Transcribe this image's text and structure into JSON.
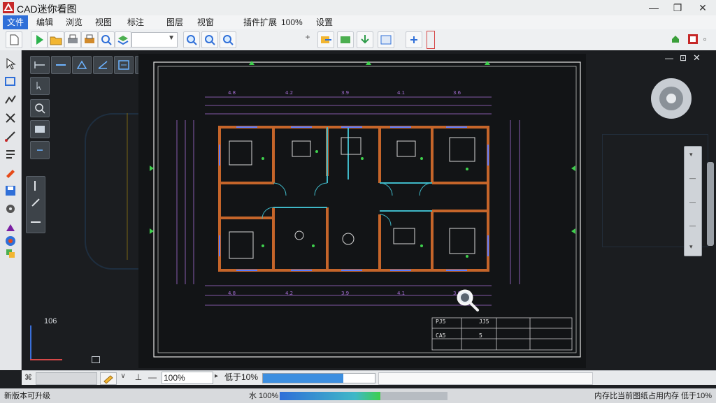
{
  "window": {
    "title": "CAD迷你看图"
  },
  "menu": {
    "items": [
      "文件",
      "编辑",
      "浏览",
      "视图",
      "标注",
      "图层",
      "视窗",
      "100%",
      "设置"
    ]
  },
  "canvas": {
    "coord_readout": "106",
    "title_block": {
      "rows": [
        [
          "PJ5",
          "JJ5",
          "",
          "",
          ""
        ],
        [
          "CA5",
          "5",
          "",
          "",
          ""
        ]
      ]
    }
  },
  "cmdbar": {
    "zoom_value": "100%",
    "threshold_label": "低于10%"
  },
  "statusbar": {
    "left_text": "新版本可升级",
    "zoom_text": "水 100%",
    "right_text": "内存比当前图纸占用内存 低于10%"
  },
  "progress": {
    "value": 0.72
  },
  "colors": {
    "accent": "#2f6fd8",
    "wall": "#c5652a",
    "dim": "#a66fd6",
    "fixture": "#3fb8c7",
    "green": "#3ecf4c"
  },
  "icons": {
    "toolbar": [
      "new-file-icon",
      "play-icon",
      "open-folder-icon",
      "print-icon",
      "print-preview-icon",
      "find-icon",
      "layers-icon",
      "zoom-icon",
      "zoom-in-icon",
      "zoom-out-icon",
      "export-icon",
      "import-icon",
      "download-icon",
      "screenshot-icon",
      "rotate-icon"
    ],
    "lefttools": [
      "select-cursor-icon",
      "window-select-icon",
      "polyline-icon",
      "trim-icon",
      "extend-icon",
      "pan-icon",
      "color-picker-icon",
      "save-icon",
      "settings-icon",
      "plot-icon",
      "info-icon",
      "layer-manager-icon"
    ]
  }
}
